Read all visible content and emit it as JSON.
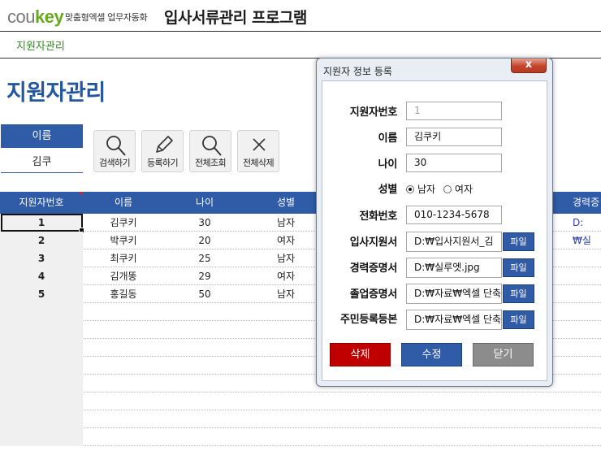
{
  "header": {
    "brand_part1": "cou",
    "brand_part2": "key",
    "brand_tagline": "맞춤형엑셀 업무자동화",
    "app_title": "입사서류관리 프로그램"
  },
  "nav": {
    "tab": "지원자관리"
  },
  "page": {
    "title": "지원자관리"
  },
  "search": {
    "label": "이름",
    "value": "김쿠"
  },
  "toolbar": {
    "search_label": "검색하기",
    "register_label": "등록하기",
    "view_all_label": "전체조회",
    "delete_all_label": "전체삭제"
  },
  "table": {
    "columns": [
      "지원자번호",
      "이름",
      "나이",
      "성별",
      "경력증"
    ],
    "rows": [
      {
        "id": "1",
        "name": "김쿠키",
        "age": "30",
        "gender": "남자",
        "career": "D:₩실"
      },
      {
        "id": "2",
        "name": "박쿠키",
        "age": "20",
        "gender": "여자",
        "career": ""
      },
      {
        "id": "3",
        "name": "최쿠키",
        "age": "25",
        "gender": "남자",
        "career": ""
      },
      {
        "id": "4",
        "name": "김개똥",
        "age": "29",
        "gender": "여자",
        "career": ""
      },
      {
        "id": "5",
        "name": "홍길동",
        "age": "50",
        "gender": "남자",
        "career": ""
      }
    ]
  },
  "dialog": {
    "title": "지원자 정보 등록",
    "close_symbol": "x",
    "fields": {
      "id_label": "지원자번호",
      "id_value": "1",
      "name_label": "이름",
      "name_value": "김쿠키",
      "age_label": "나이",
      "age_value": "30",
      "gender_label": "성별",
      "gender_male": "남자",
      "gender_female": "여자",
      "phone_label": "전화번호",
      "phone_value": "010-1234-5678",
      "resume_label": "입사지원서",
      "resume_value": "D:₩입사지원서_김",
      "career_label": "경력증명서",
      "career_value": "D:₩실루엣.jpg",
      "grad_label": "졸업증명서",
      "grad_value": "D:₩자료₩엑셀 단축",
      "resident_label": "주민등록등본",
      "resident_value": "D:₩자료₩엑셀 단축"
    },
    "file_button_label": "파일",
    "delete_label": "삭제",
    "edit_label": "수정",
    "close_label": "닫기"
  },
  "colors": {
    "accent_blue": "#2f5ba7",
    "title_blue": "#24589e",
    "brand_green": "#6aaa1f",
    "delete_red": "#c00000",
    "close_gray": "#8c8c8c"
  },
  "icons": [
    "search-icon",
    "pencil-icon",
    "search-icon",
    "x-icon"
  ]
}
